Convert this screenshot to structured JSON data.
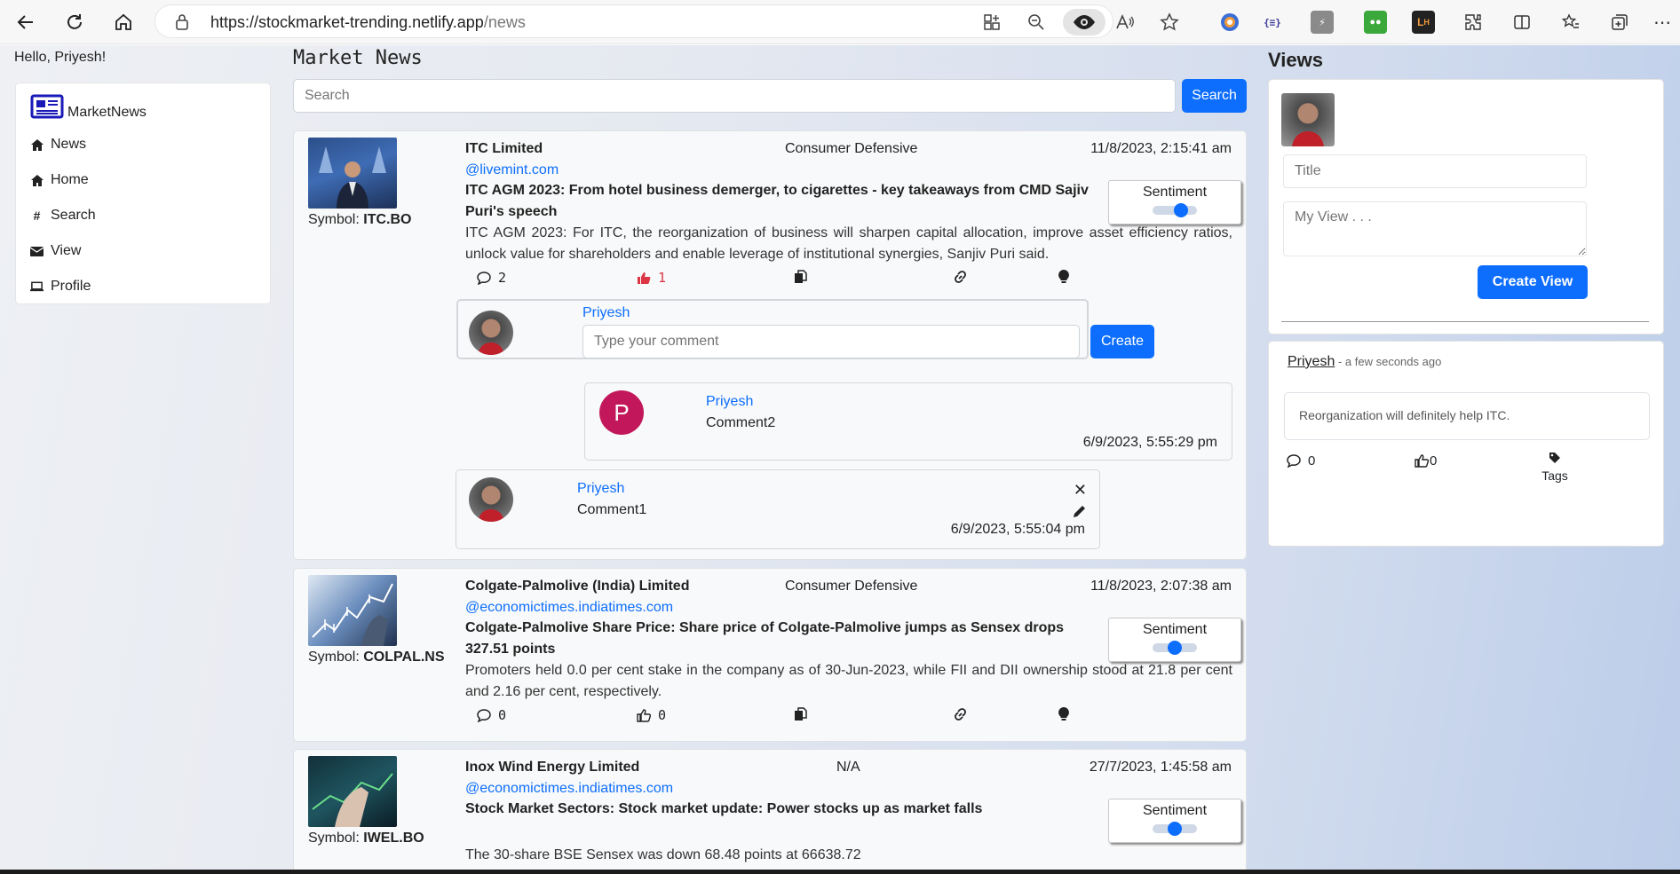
{
  "browser": {
    "url_host": "https://stockmarket-trending.netlify.app",
    "url_path": "/news",
    "extensions": [
      "color-icon",
      "json-icon",
      "code-icon",
      "frog-icon",
      "lh-icon"
    ]
  },
  "greeting": "Hello, Priyesh!",
  "sidebar": {
    "brand": "MarketNews",
    "items": [
      {
        "label": "News",
        "icon": "home-icon"
      },
      {
        "label": "Home",
        "icon": "home-icon"
      },
      {
        "label": "Search",
        "icon": "hash-icon"
      },
      {
        "label": "View",
        "icon": "envelope-icon"
      },
      {
        "label": "Profile",
        "icon": "laptop-icon"
      }
    ]
  },
  "news": {
    "title": "Market News",
    "search_placeholder": "Search",
    "search_button": "Search",
    "articles": [
      {
        "symbol_label": "Symbol: ",
        "symbol": "ITC.BO",
        "company": "ITC Limited",
        "sector": "Consumer Defensive",
        "date": "11/8/2023, 2:15:41 am",
        "source": "@livemint.com",
        "headline": "ITC AGM 2023: From hotel business demerger, to cigarettes - key takeaways from CMD Sajiv Puri's speech",
        "summary": "ITC AGM 2023: For ITC, the reorganization of business will sharpen capital allocation, improve asset efficiency ratios, unlock value for shareholders and enable leverage of institutional synergies, Sanjiv Puri said.",
        "sentiment_label": "Sentiment",
        "sentiment_value": 0.7,
        "comments_count": "2",
        "likes_count": "1",
        "liked": true
      },
      {
        "symbol_label": "Symbol: ",
        "symbol": "COLPAL.NS",
        "company": "Colgate-Palmolive (India) Limited",
        "sector": "Consumer Defensive",
        "date": "11/8/2023, 2:07:38 am",
        "source": "@economictimes.indiatimes.com",
        "headline": "Colgate-Palmolive Share Price: Share price of Colgate-Palmolive jumps as Sensex drops 327.51 points",
        "summary": "Promoters held 0.0 per cent stake in the company as of 30-Jun-2023, while FII and DII ownership stood at 21.8 per cent and 2.16 per cent, respectively.",
        "sentiment_label": "Sentiment",
        "sentiment_value": 0.5,
        "comments_count": "0",
        "likes_count": "0",
        "liked": false
      },
      {
        "symbol_label": "Symbol: ",
        "symbol": "IWEL.BO",
        "company": "Inox Wind Energy Limited",
        "sector": "N/A",
        "date": "27/7/2023, 1:45:58 am",
        "source": "@economictimes.indiatimes.com",
        "headline": "Stock Market Sectors: Stock market update: Power stocks up as market falls",
        "summary": "The 30-share BSE Sensex was down 68.48 points at 66638.72",
        "sentiment_label": "Sentiment",
        "sentiment_value": 0.5
      }
    ],
    "comment_form": {
      "name": "Priyesh",
      "placeholder": "Type your comment",
      "button": "Create"
    },
    "comments": [
      {
        "avatar_letter": "P",
        "name": "Priyesh",
        "text": "Comment2",
        "time": "6/9/2023, 5:55:29 pm"
      },
      {
        "name": "Priyesh",
        "text": "Comment1",
        "time": "6/9/2023, 5:55:04 pm"
      }
    ]
  },
  "views": {
    "title": "Views",
    "title_placeholder": "Title",
    "body_placeholder": "My View . . .",
    "create_button": "Create View",
    "items": [
      {
        "author": "Priyesh",
        "meta": " - a few seconds ago",
        "text": "Reorganization will definitely help ITC.",
        "comments": "0",
        "likes": "0",
        "tags_label": "Tags"
      }
    ]
  },
  "colors": {
    "primary": "#0d6efd",
    "like_red": "#dc3545",
    "avatar_magenta": "#c2185b"
  }
}
